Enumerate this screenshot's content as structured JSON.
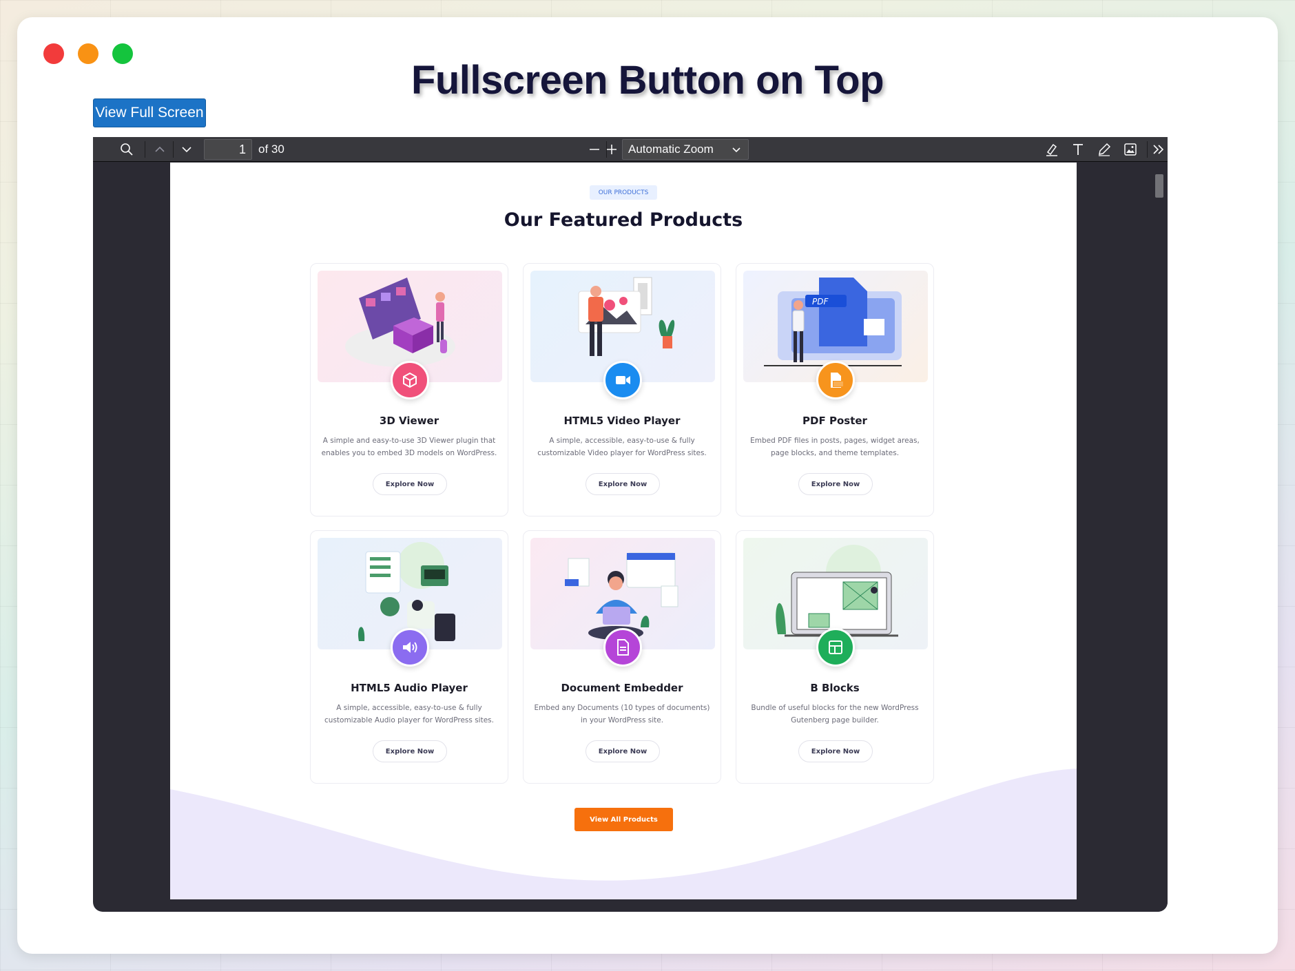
{
  "window": {
    "title": "Fullscreen Button on Top",
    "controls": [
      "close",
      "minimize",
      "maximize"
    ]
  },
  "fullscreen_button": {
    "label": "View Full Screen",
    "color": "#1c73c6"
  },
  "pdf_viewer": {
    "toolbar": {
      "current_page": "1",
      "page_count_label": "of 30",
      "zoom_label": "Automatic Zoom",
      "left_icons": [
        "search-icon",
        "previous-page-icon",
        "next-page-icon"
      ],
      "right_icons": [
        "highlight-icon",
        "text-icon",
        "draw-icon",
        "image-icon",
        "tools-menu-icon"
      ]
    }
  },
  "document": {
    "badge": "OUR PRODUCTS",
    "heading": "Our Featured Products",
    "products": [
      {
        "title": "3D Viewer",
        "description": "A simple and easy-to-use 3D Viewer plugin that enables you to embed 3D models on WordPress.",
        "button": "Explore Now",
        "icon": "cube-icon",
        "accent": "#f0507a"
      },
      {
        "title": "HTML5 Video Player",
        "description": "A simple, accessible, easy-to-use & fully customizable Video player for WordPress sites.",
        "button": "Explore Now",
        "icon": "video-camera-icon",
        "accent": "#1a8cf0"
      },
      {
        "title": "PDF Poster",
        "description": "Embed PDF files in posts, pages, widget areas, page blocks, and theme templates.",
        "button": "Explore Now",
        "icon": "pdf-file-icon",
        "accent": "#f7941d",
        "illustration_label": "PDF"
      },
      {
        "title": "HTML5 Audio Player",
        "description": "A simple, accessible, easy-to-use & fully customizable Audio player for WordPress sites.",
        "button": "Explore Now",
        "icon": "speaker-icon",
        "accent": "#8b6cf0"
      },
      {
        "title": "Document Embedder",
        "description": "Embed any Documents (10 types of documents) in your WordPress site.",
        "button": "Explore Now",
        "icon": "document-icon",
        "accent": "#b545d8"
      },
      {
        "title": "B Blocks",
        "description": "Bundle of useful blocks for the new WordPress Gutenberg page builder.",
        "button": "Explore Now",
        "icon": "blocks-icon",
        "accent": "#1fae5a"
      }
    ],
    "view_all_button": "View All Products",
    "accent_orange": "#f6700d"
  }
}
